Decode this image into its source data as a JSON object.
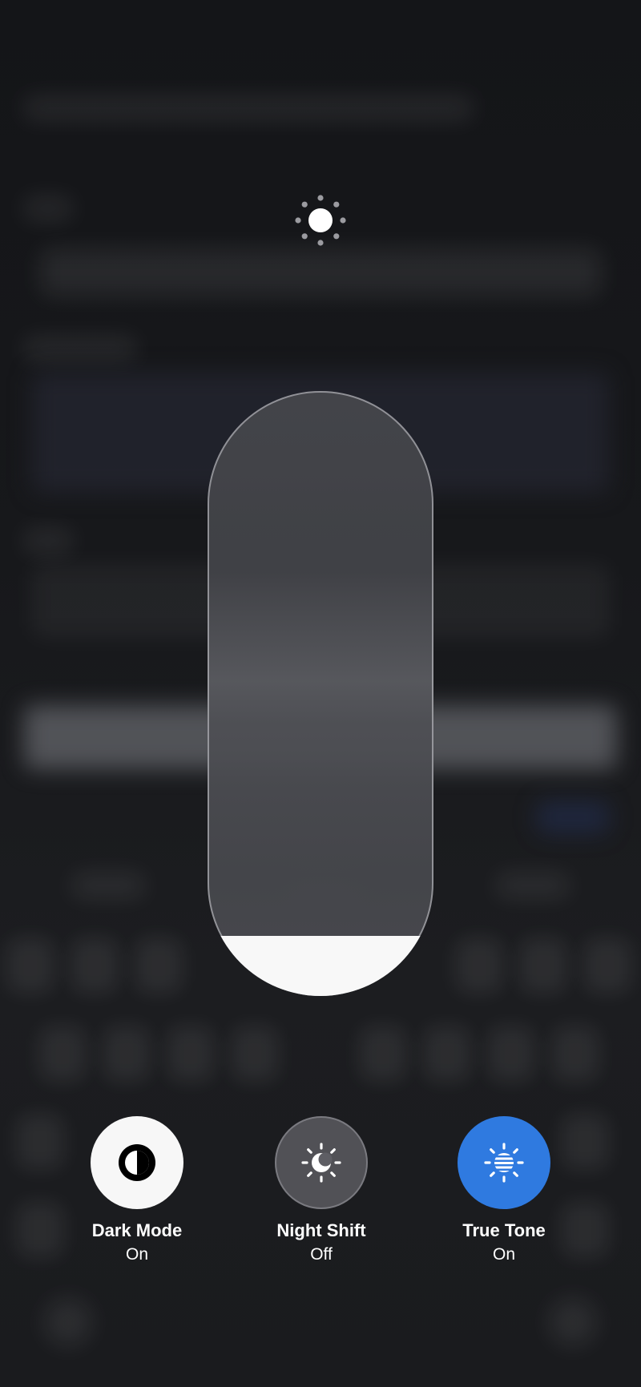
{
  "brightness": {
    "icon": "sun-icon",
    "level": 0.1
  },
  "toggles": [
    {
      "label": "Dark Mode",
      "state": "On",
      "icon": "dark-mode-icon",
      "active_color": "#f7f7f7"
    },
    {
      "label": "Night Shift",
      "state": "Off",
      "icon": "night-shift-icon"
    },
    {
      "label": "True Tone",
      "state": "On",
      "icon": "true-tone-icon",
      "active_color": "#2f7ae0"
    }
  ]
}
